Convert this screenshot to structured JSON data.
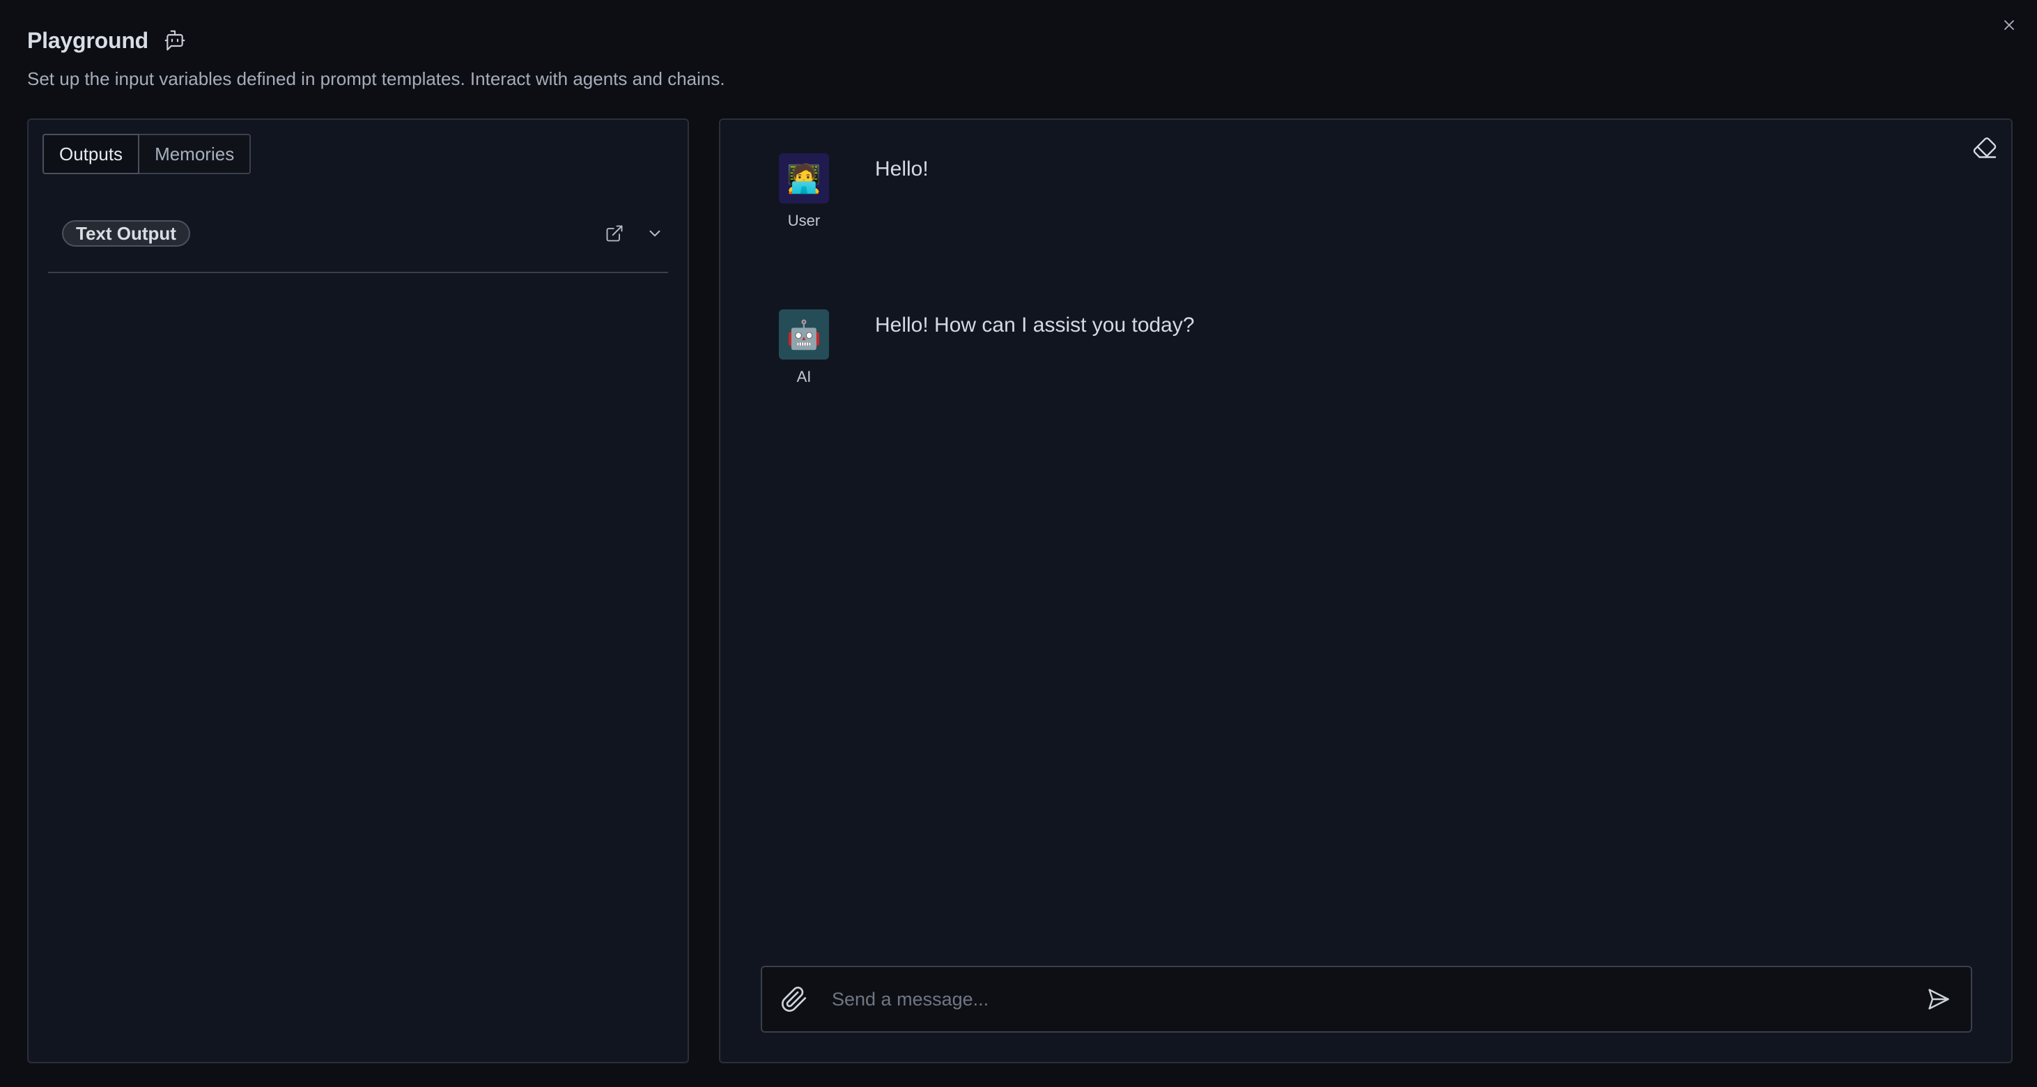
{
  "header": {
    "title": "Playground",
    "title_icon": "bot-message-square-icon",
    "subtitle": "Set up the input variables defined in prompt templates. Interact with agents and chains.",
    "close_icon": "close-icon"
  },
  "left_panel": {
    "tabs": [
      {
        "label": "Outputs",
        "active": true
      },
      {
        "label": "Memories",
        "active": false
      }
    ],
    "outputs": [
      {
        "label": "Text Output",
        "actions": [
          "external-link-icon",
          "chevron-down-icon"
        ]
      }
    ]
  },
  "chat": {
    "clear_icon": "eraser-icon",
    "messages": [
      {
        "sender": "User",
        "avatar": "🧑‍💻",
        "text": "Hello!"
      },
      {
        "sender": "AI",
        "avatar": "🤖",
        "text": "Hello! How can I assist you today?"
      }
    ],
    "composer": {
      "placeholder": "Send a message...",
      "attach_icon": "paperclip-icon",
      "send_icon": "send-icon"
    }
  },
  "colors": {
    "background": "#0c0e13",
    "panel": "#111520",
    "border": "#2a2f3a",
    "user_avatar_bg": "#1f1b4e",
    "ai_avatar_bg": "#254d57"
  }
}
